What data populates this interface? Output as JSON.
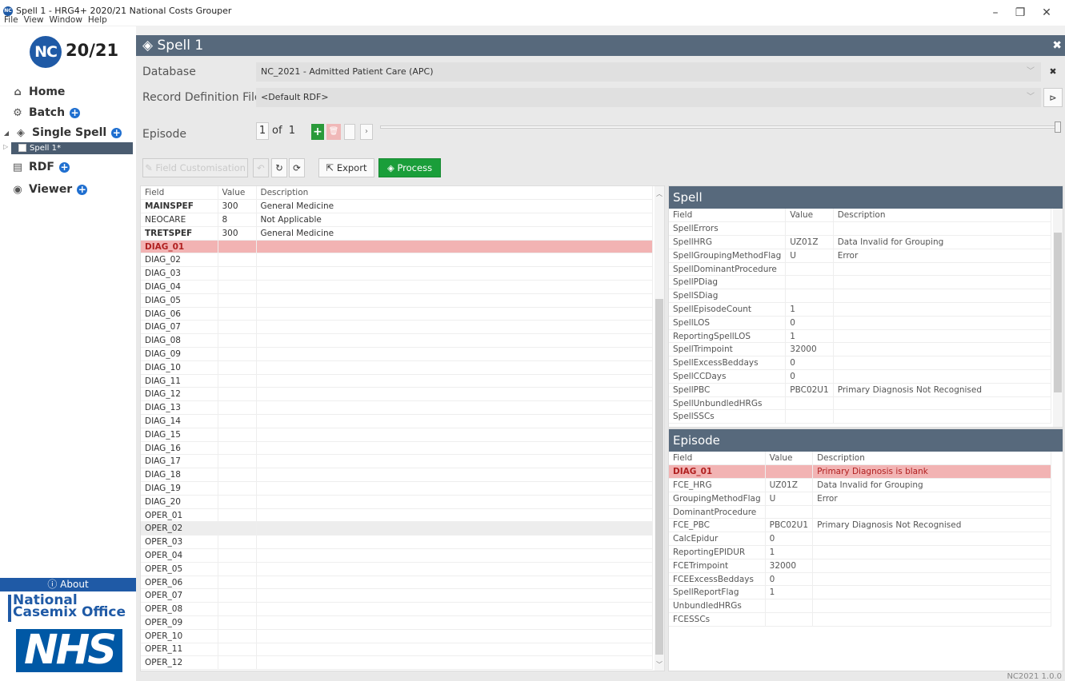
{
  "window": {
    "title": "Spell 1 - HRG4+ 2020/21 National Costs Grouper",
    "app_icon": "NC",
    "menu": [
      "File",
      "View",
      "Window",
      "Help"
    ]
  },
  "sidebar": {
    "logo_initials": "NC",
    "logo_year": "20/21",
    "home": "Home",
    "batch": "Batch",
    "single_spell": "Single Spell",
    "tree_item": "Spell 1*",
    "rdf": "RDF",
    "viewer": "Viewer",
    "about": "About",
    "nco_line1": "National",
    "nco_line2": "Casemix Office",
    "nhs": "NHS"
  },
  "header": {
    "title": "Spell 1"
  },
  "form": {
    "database_label": "Database",
    "database_value": "NC_2021 - Admitted Patient Care (APC)",
    "rdf_label": "Record Definition File",
    "rdf_value": "<Default RDF>",
    "episode_label": "Episode",
    "episode_current": "1",
    "episode_of": "of",
    "episode_total": "1"
  },
  "toolbar": {
    "field_customisation": "Field Customisation",
    "export": "Export",
    "process": "Process"
  },
  "left_grid": {
    "headers": [
      "Field",
      "Value",
      "Description"
    ],
    "rows": [
      {
        "field": "MAINSPEF",
        "value": "300",
        "desc": "General Medicine",
        "style": "bold"
      },
      {
        "field": "NEOCARE",
        "value": "8",
        "desc": "Not Applicable",
        "style": ""
      },
      {
        "field": "TRETSPEF",
        "value": "300",
        "desc": "General Medicine",
        "style": "bold"
      },
      {
        "field": "DIAG_01",
        "value": "",
        "desc": "",
        "style": "err"
      },
      {
        "field": "DIAG_02",
        "value": "",
        "desc": "",
        "style": ""
      },
      {
        "field": "DIAG_03",
        "value": "",
        "desc": "",
        "style": ""
      },
      {
        "field": "DIAG_04",
        "value": "",
        "desc": "",
        "style": ""
      },
      {
        "field": "DIAG_05",
        "value": "",
        "desc": "",
        "style": ""
      },
      {
        "field": "DIAG_06",
        "value": "",
        "desc": "",
        "style": ""
      },
      {
        "field": "DIAG_07",
        "value": "",
        "desc": "",
        "style": ""
      },
      {
        "field": "DIAG_08",
        "value": "",
        "desc": "",
        "style": ""
      },
      {
        "field": "DIAG_09",
        "value": "",
        "desc": "",
        "style": ""
      },
      {
        "field": "DIAG_10",
        "value": "",
        "desc": "",
        "style": ""
      },
      {
        "field": "DIAG_11",
        "value": "",
        "desc": "",
        "style": ""
      },
      {
        "field": "DIAG_12",
        "value": "",
        "desc": "",
        "style": ""
      },
      {
        "field": "DIAG_13",
        "value": "",
        "desc": "",
        "style": ""
      },
      {
        "field": "DIAG_14",
        "value": "",
        "desc": "",
        "style": ""
      },
      {
        "field": "DIAG_15",
        "value": "",
        "desc": "",
        "style": ""
      },
      {
        "field": "DIAG_16",
        "value": "",
        "desc": "",
        "style": ""
      },
      {
        "field": "DIAG_17",
        "value": "",
        "desc": "",
        "style": ""
      },
      {
        "field": "DIAG_18",
        "value": "",
        "desc": "",
        "style": ""
      },
      {
        "field": "DIAG_19",
        "value": "",
        "desc": "",
        "style": ""
      },
      {
        "field": "DIAG_20",
        "value": "",
        "desc": "",
        "style": ""
      },
      {
        "field": "OPER_01",
        "value": "",
        "desc": "",
        "style": ""
      },
      {
        "field": "OPER_02",
        "value": "",
        "desc": "",
        "style": "alt"
      },
      {
        "field": "OPER_03",
        "value": "",
        "desc": "",
        "style": ""
      },
      {
        "field": "OPER_04",
        "value": "",
        "desc": "",
        "style": ""
      },
      {
        "field": "OPER_05",
        "value": "",
        "desc": "",
        "style": ""
      },
      {
        "field": "OPER_06",
        "value": "",
        "desc": "",
        "style": ""
      },
      {
        "field": "OPER_07",
        "value": "",
        "desc": "",
        "style": ""
      },
      {
        "field": "OPER_08",
        "value": "",
        "desc": "",
        "style": ""
      },
      {
        "field": "OPER_09",
        "value": "",
        "desc": "",
        "style": ""
      },
      {
        "field": "OPER_10",
        "value": "",
        "desc": "",
        "style": ""
      },
      {
        "field": "OPER_11",
        "value": "",
        "desc": "",
        "style": ""
      },
      {
        "field": "OPER_12",
        "value": "",
        "desc": "",
        "style": ""
      }
    ]
  },
  "spell_panel": {
    "title": "Spell",
    "headers": [
      "Field",
      "Value",
      "Description"
    ],
    "rows": [
      {
        "field": "SpellErrors",
        "value": "",
        "desc": ""
      },
      {
        "field": "SpellHRG",
        "value": "UZ01Z",
        "desc": "Data Invalid for Grouping"
      },
      {
        "field": "SpellGroupingMethodFlag",
        "value": "U",
        "desc": "Error"
      },
      {
        "field": "SpellDominantProcedure",
        "value": "",
        "desc": ""
      },
      {
        "field": "SpellPDiag",
        "value": "",
        "desc": ""
      },
      {
        "field": "SpellSDiag",
        "value": "",
        "desc": ""
      },
      {
        "field": "SpellEpisodeCount",
        "value": "1",
        "desc": ""
      },
      {
        "field": "SpellLOS",
        "value": "0",
        "desc": ""
      },
      {
        "field": "ReportingSpellLOS",
        "value": "1",
        "desc": ""
      },
      {
        "field": "SpellTrimpoint",
        "value": "32000",
        "desc": ""
      },
      {
        "field": "SpellExcessBeddays",
        "value": "0",
        "desc": ""
      },
      {
        "field": "SpellCCDays",
        "value": "0",
        "desc": ""
      },
      {
        "field": "SpellPBC",
        "value": "PBC02U1",
        "desc": "Primary Diagnosis Not Recognised"
      },
      {
        "field": "SpellUnbundledHRGs",
        "value": "",
        "desc": ""
      },
      {
        "field": "SpellSSCs",
        "value": "",
        "desc": ""
      }
    ]
  },
  "episode_panel": {
    "title": "Episode",
    "headers": [
      "Field",
      "Value",
      "Description"
    ],
    "rows": [
      {
        "field": "DIAG_01",
        "value": "",
        "desc": "Primary Diagnosis is blank",
        "style": "err"
      },
      {
        "field": "FCE_HRG",
        "value": "UZ01Z",
        "desc": "Data Invalid for Grouping",
        "style": ""
      },
      {
        "field": "GroupingMethodFlag",
        "value": "U",
        "desc": "Error",
        "style": ""
      },
      {
        "field": "DominantProcedure",
        "value": "",
        "desc": "",
        "style": ""
      },
      {
        "field": "FCE_PBC",
        "value": "PBC02U1",
        "desc": "Primary Diagnosis Not Recognised",
        "style": ""
      },
      {
        "field": "CalcEpidur",
        "value": "0",
        "desc": "",
        "style": ""
      },
      {
        "field": "ReportingEPIDUR",
        "value": "1",
        "desc": "",
        "style": ""
      },
      {
        "field": "FCETrimpoint",
        "value": "32000",
        "desc": "",
        "style": ""
      },
      {
        "field": "FCEExcessBeddays",
        "value": "0",
        "desc": "",
        "style": ""
      },
      {
        "field": "SpellReportFlag",
        "value": "1",
        "desc": "",
        "style": ""
      },
      {
        "field": "UnbundledHRGs",
        "value": "",
        "desc": "",
        "style": ""
      },
      {
        "field": "FCESSCs",
        "value": "",
        "desc": "",
        "style": ""
      }
    ]
  },
  "status": {
    "version": "NC2021 1.0.0"
  }
}
